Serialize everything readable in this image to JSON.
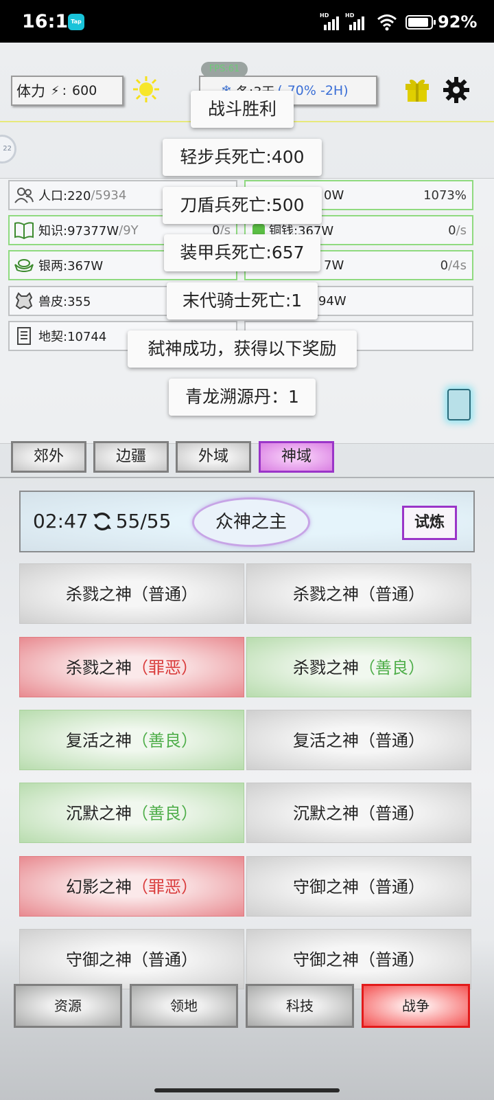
{
  "status_bar": {
    "time": "16:13",
    "app_badge": "Tap",
    "signal1": "HD",
    "signal2": "HD",
    "battery": "92%"
  },
  "top_bar": {
    "stamina_label": "体力",
    "stamina_sep": ":",
    "stamina_value": "600",
    "fps_badge": "FPS:61",
    "season_label": "冬:3天",
    "season_modifier": "(-70% -2H)"
  },
  "avatar_text": "22",
  "resources": {
    "population_label": "人口:220",
    "population_max": "/5934",
    "knowledge_label": "知识:97377W",
    "knowledge_max": "/9Y",
    "knowledge_rate": "0",
    "knowledge_unit": "/s",
    "silver_label": "银两:367W",
    "hide_label": "兽皮:355",
    "deed_label": "地契:10744",
    "right1_value": "0W",
    "right1_rate": "1073%",
    "copper_label": "铜钱:367W",
    "copper_rate": "0",
    "copper_unit": "/s",
    "right3_value": "7W",
    "right3_rate": "0",
    "right3_unit": "/4s",
    "right4_value": "94W"
  },
  "toasts": [
    "战斗胜利",
    "轻步兵死亡:400",
    "刀盾兵死亡:500",
    "装甲兵死亡:657",
    "末代骑士死亡:1",
    "弑神成功，获得以下奖励",
    "青龙溯源丹：1"
  ],
  "region_tabs": [
    "郊外",
    "边疆",
    "外域",
    "神域"
  ],
  "god_header": {
    "timer": "02:47",
    "count": "55/55",
    "title": "众神之主",
    "trial_button": "试炼"
  },
  "gods": [
    {
      "name": "杀戮之神",
      "tag": "（普通）",
      "type": "normal"
    },
    {
      "name": "杀戮之神",
      "tag": "（普通）",
      "type": "normal"
    },
    {
      "name": "杀戮之神",
      "tag": "（罪恶）",
      "type": "evil"
    },
    {
      "name": "杀戮之神",
      "tag": "（善良）",
      "type": "good"
    },
    {
      "name": "复活之神",
      "tag": "（善良）",
      "type": "good"
    },
    {
      "name": "复活之神",
      "tag": "（普通）",
      "type": "normal"
    },
    {
      "name": "沉默之神",
      "tag": "（善良）",
      "type": "good"
    },
    {
      "name": "沉默之神",
      "tag": "（普通）",
      "type": "normal"
    },
    {
      "name": "幻影之神",
      "tag": "（罪恶）",
      "type": "evil"
    },
    {
      "name": "守御之神",
      "tag": "（普通）",
      "type": "normal"
    },
    {
      "name": "守御之神",
      "tag": "（普通）",
      "type": "normal"
    },
    {
      "name": "守御之神",
      "tag": "（普通）",
      "type": "normal"
    }
  ],
  "nav": [
    "资源",
    "领地",
    "科技",
    "战争"
  ],
  "colors": {
    "evil": "#d93a3a",
    "good": "#4fae4a",
    "active_tab": "#9a35c8",
    "active_nav": "#e21a1a"
  }
}
